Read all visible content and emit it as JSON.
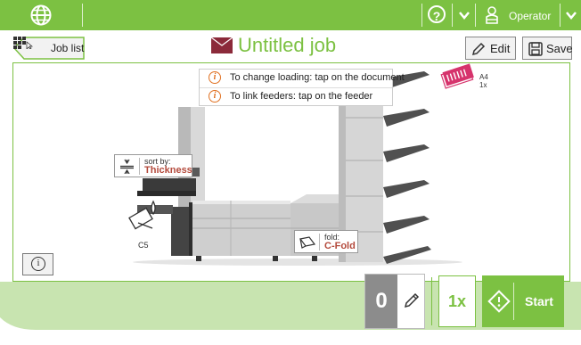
{
  "topbar": {
    "help_glyph": "?",
    "user_label": "Operator",
    "icons": [
      "globe-icon",
      "help-icon",
      "chevron-down-icon",
      "user-icon"
    ]
  },
  "header": {
    "job_list_label": "Job list",
    "title": "Untitled job",
    "edit_label": "Edit",
    "save_label": "Save"
  },
  "tips": [
    "To change loading: tap on the document",
    "To link feeders: tap on the feeder"
  ],
  "machine": {
    "sort_label": "sort by:",
    "sort_value": "Thickness",
    "fold_label": "fold:",
    "fold_value": "C-Fold",
    "envelope_label": "C5",
    "document_label": "A4",
    "document_count": "1x"
  },
  "bottom": {
    "counter": "0",
    "quantity": "1x",
    "start_label": "Start"
  },
  "colors": {
    "brand_green": "#7cc142",
    "value_red": "#b44a3c",
    "tip_orange": "#e07020",
    "document_pink": "#d6336c"
  }
}
